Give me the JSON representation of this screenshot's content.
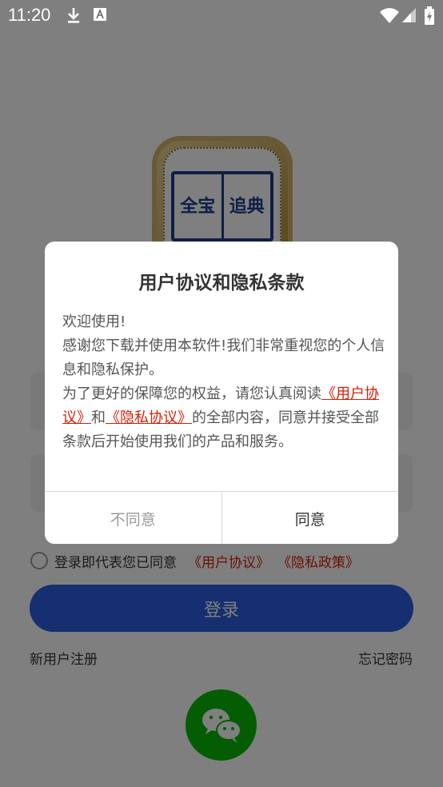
{
  "status_bar": {
    "time": "11:20"
  },
  "app_logo": {
    "chars": [
      "全",
      "宝",
      "追",
      "典"
    ]
  },
  "agreement_row": {
    "text": "登录即代表您已同意",
    "link_user_agreement": "《用户协议》",
    "link_privacy_policy": "《隐私政策》"
  },
  "login_button": {
    "label": "登录"
  },
  "bottom_links": {
    "register": "新用户注册",
    "forgot_password": "忘记密码"
  },
  "dialog": {
    "title": "用户协议和隐私条款",
    "line1": "欢迎使用!",
    "line2": "感谢您下载并使用本软件!我们非常重视您的个人信息和隐私保护。",
    "line3_prefix": "为了更好的保障您的权益，请您认真阅读",
    "link_user_agreement": "《用户协议》",
    "and": "和",
    "link_privacy_agreement": "《隐私协议》",
    "line3_suffix": "的全部内容，同意并接受全部条款后开始使用我们的产品和服务。",
    "disagree_label": "不同意",
    "agree_label": "同意"
  },
  "colors": {
    "accent_red": "#d81e06",
    "primary_blue": "#2b5fe0",
    "wechat_green": "#09bb07"
  }
}
